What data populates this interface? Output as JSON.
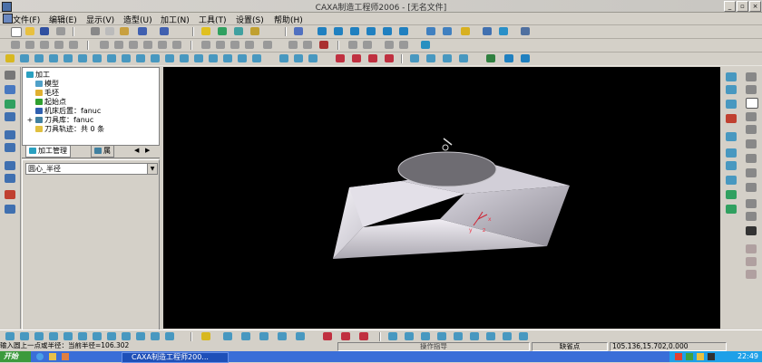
{
  "window": {
    "title": "CAXA制造工程师2006 - [无名文件]",
    "minimize_glyph": "_",
    "restore_glyph": "▫",
    "close_glyph": "×"
  },
  "menu": [
    "文件(F)",
    "编辑(E)",
    "显示(V)",
    "造型(U)",
    "加工(N)",
    "工具(T)",
    "设置(S)",
    "帮助(H)"
  ],
  "tree": {
    "root": "加工",
    "items": [
      "模型",
      "毛坯",
      "起始点",
      "机床后置：fanuc",
      "刀具库：fanuc",
      "刀具轨迹：共 0 条"
    ],
    "expand_glyph": "+"
  },
  "tabs": {
    "tab1": "加工管理",
    "tab2": "属"
  },
  "property": {
    "combo_value": "圆心_半径",
    "combo_arrow": "▼"
  },
  "viewport": {
    "axis_x": "x",
    "axis_y": "y",
    "axis_z": "z",
    "bg_color": "#000000",
    "solid_color": "#e6e3ea"
  },
  "status": {
    "prompt": "输入圆上一点或半径：当前半径=106.302",
    "instruction": "操作指导",
    "snap_mode": "缺省点",
    "coords": "105.136,15.702,0.000"
  },
  "taskbar": {
    "start_label": "开始",
    "task_label": "CAXA制造工程师200...",
    "clock": "22:49"
  },
  "icons": {
    "toolbar": [
      "new-file-icon",
      "open-file-icon",
      "save-icon",
      "print-icon",
      "cut-icon",
      "copy-icon",
      "paste-icon",
      "undo-icon",
      "redo-icon",
      "shade-icon",
      "render-icon",
      "zoom-icon",
      "pan-icon",
      "rotate-icon",
      "layer-icon"
    ]
  }
}
